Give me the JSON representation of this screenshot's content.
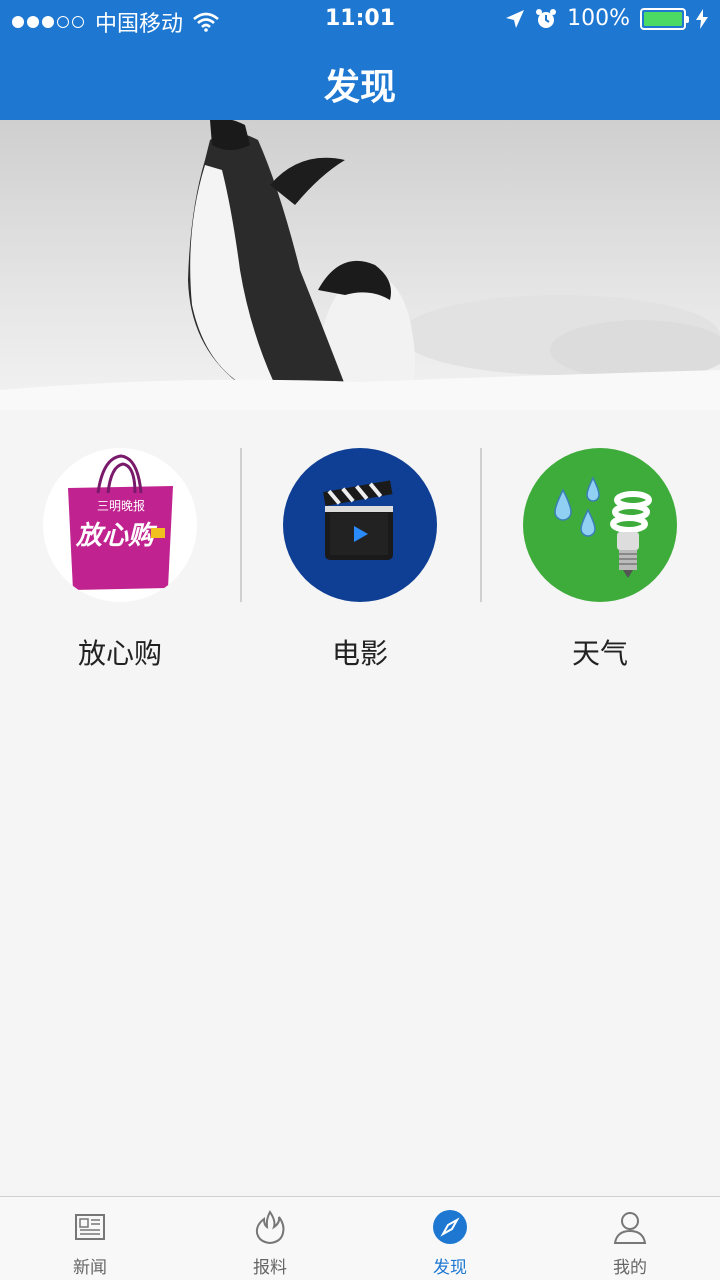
{
  "status_bar": {
    "carrier": "中国移动",
    "time": "11:01",
    "battery": "100%"
  },
  "header": {
    "title": "发现"
  },
  "features": [
    {
      "label": "放心购",
      "icon": "shopping-bag-icon",
      "color": "#c0228f"
    },
    {
      "label": "电影",
      "icon": "clapperboard-icon",
      "color": "#0f3f95"
    },
    {
      "label": "天气",
      "icon": "weather-icon",
      "color": "#3eac3a"
    }
  ],
  "shop_icon_text": {
    "main": "放心购",
    "brand": "三明晚报"
  },
  "tabs": [
    {
      "label": "新闻",
      "icon": "newspaper-icon",
      "active": false
    },
    {
      "label": "报料",
      "icon": "flame-icon",
      "active": false
    },
    {
      "label": "发现",
      "icon": "compass-icon",
      "active": true
    },
    {
      "label": "我的",
      "icon": "person-icon",
      "active": false
    }
  ],
  "colors": {
    "accent": "#1e78d2",
    "background": "#f5f5f5"
  }
}
